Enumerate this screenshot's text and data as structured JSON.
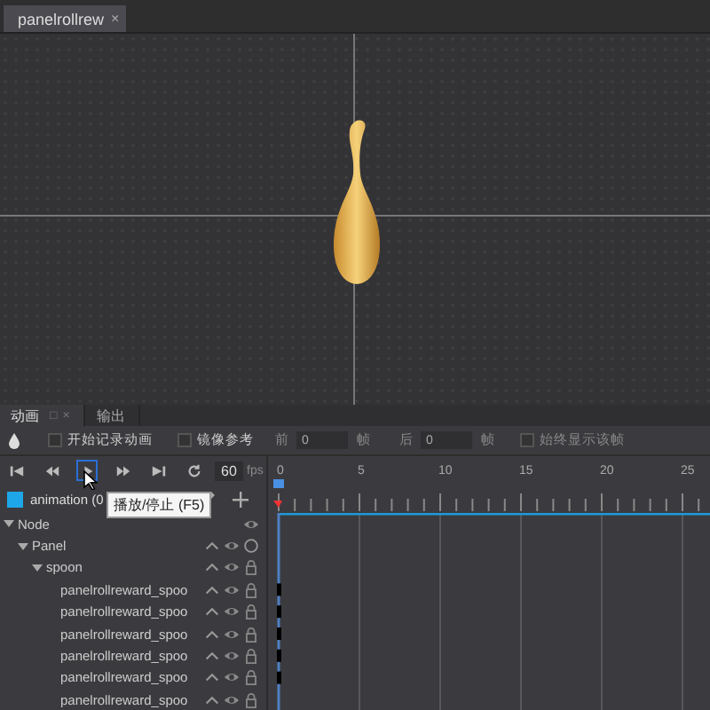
{
  "document_tab": {
    "title": "panelrollrew",
    "close": "×",
    "selected": true
  },
  "panel_tabs": [
    {
      "label": "动画",
      "selected": true,
      "menu": "□",
      "close": "×"
    },
    {
      "label": "输出",
      "selected": false
    }
  ],
  "options": {
    "record": {
      "label": "开始记录动画",
      "checked": false
    },
    "mirror": {
      "label": "镜像参考",
      "checked": false
    },
    "before": {
      "label": "前",
      "value": "0",
      "unit": "帧"
    },
    "after": {
      "label": "后",
      "value": "0",
      "unit": "帧"
    },
    "always_show": {
      "label": "始终显示该帧",
      "checked": false
    }
  },
  "controls": [
    {
      "kind": "first",
      "selected": false
    },
    {
      "kind": "prev",
      "selected": false
    },
    {
      "kind": "play",
      "selected": true
    },
    {
      "kind": "next",
      "selected": false
    },
    {
      "kind": "last",
      "selected": false
    },
    {
      "kind": "loop",
      "selected": false
    }
  ],
  "fps": {
    "value": "60",
    "unit": "fps"
  },
  "clip": {
    "name": "animation (0",
    "color": "#1ea7e8"
  },
  "tooltip": "播放/停止 (F5)",
  "ruler": {
    "labels": [
      "0",
      "5",
      "10",
      "15",
      "20",
      "25"
    ]
  },
  "tree": [
    {
      "name": "Node",
      "kind": "root",
      "expanded": true,
      "children": [
        {
          "name": "Panel",
          "kind": "group",
          "expanded": true,
          "children": [
            {
              "name": "spoon",
              "kind": "node",
              "expanded": true,
              "children": [
                {
                  "name": "panelrollreward_spoo",
                  "kind": "node",
                  "keyframe": true
                },
                {
                  "name": "panelrollreward_spoo",
                  "kind": "node",
                  "keyframe": true
                },
                {
                  "name": "panelrollreward_spoo",
                  "kind": "node",
                  "keyframe": true
                },
                {
                  "name": "panelrollreward_spoo",
                  "kind": "node",
                  "keyframe": true
                },
                {
                  "name": "panelrollreward_spoo",
                  "kind": "node",
                  "keyframe": true
                },
                {
                  "name": "panelrollreward_spoo",
                  "kind": "node"
                }
              ]
            }
          ]
        }
      ]
    }
  ]
}
